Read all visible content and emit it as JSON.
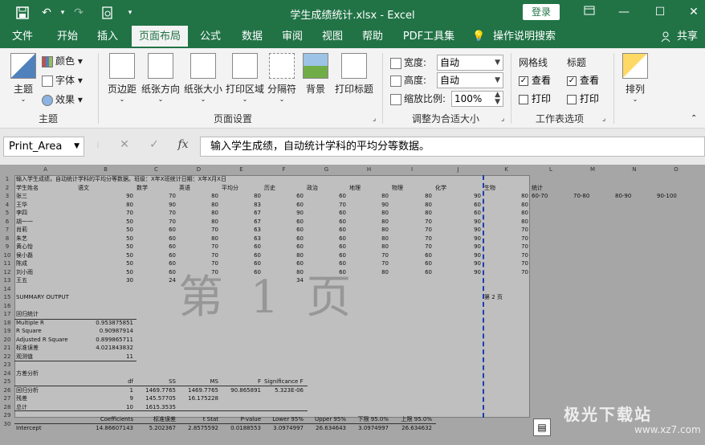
{
  "title": {
    "filename": "学生成绩统计.xlsx",
    "app": "Excel",
    "login": "登录"
  },
  "tabs": [
    "文件",
    "开始",
    "插入",
    "页面布局",
    "公式",
    "数据",
    "审阅",
    "视图",
    "帮助",
    "PDF工具集",
    "操作说明搜索",
    "共享"
  ],
  "ribbon": {
    "theme": {
      "big": "主题",
      "colors": "颜色",
      "fonts": "字体",
      "effects": "效果",
      "group": "主题"
    },
    "page_setup": {
      "margins": "页边距",
      "orientation": "纸张方向",
      "size": "纸张大小",
      "print_area": "打印区域",
      "breaks": "分隔符",
      "background": "背景",
      "print_titles": "打印标题",
      "group": "页面设置"
    },
    "scale": {
      "width_label": "宽度:",
      "width_value": "自动",
      "height_label": "高度:",
      "height_value": "自动",
      "scale_label": "缩放比例:",
      "scale_value": "100%",
      "group": "调整为合适大小"
    },
    "sheet_options": {
      "gridlines": "网格线",
      "headings": "标题",
      "view": "查看",
      "print": "打印",
      "view2": "查看",
      "print2": "打印",
      "group": "工作表选项"
    },
    "arrange": {
      "label": "排列"
    }
  },
  "formula": {
    "namebox": "Print_Area",
    "fx": "fx",
    "content": "输入学生成绩，自动统计学科的平均分等数据。"
  },
  "columns": [
    "A",
    "B",
    "C",
    "D",
    "E",
    "F",
    "G",
    "H",
    "I",
    "J",
    "K",
    "L",
    "M",
    "N",
    "O"
  ],
  "rows": [
    "1",
    "2",
    "3",
    "4",
    "5",
    "6",
    "7",
    "8",
    "9",
    "10",
    "11",
    "12",
    "13",
    "14",
    "15",
    "16",
    "17",
    "18",
    "19",
    "20",
    "21",
    "22",
    "23",
    "24",
    "25",
    "26",
    "27",
    "28",
    "29",
    "30"
  ],
  "sheet": {
    "row1": "输入学生成绩，自动统计学科的平均分等数据。班级：X年X班统计日期：X年X月X日",
    "header": [
      "学生姓名",
      "语文",
      "数学",
      "英语",
      "平均分",
      "历史",
      "政治",
      "地理",
      "物理",
      "化学",
      "生物"
    ],
    "students": [
      [
        "张三",
        "90",
        "70",
        "80",
        "80",
        "60",
        "60",
        "80",
        "80",
        "90",
        "80"
      ],
      [
        "王华",
        "80",
        "90",
        "80",
        "83",
        "60",
        "70",
        "90",
        "80",
        "60",
        "80"
      ],
      [
        "李四",
        "70",
        "70",
        "80",
        "67",
        "90",
        "60",
        "80",
        "80",
        "60",
        "80"
      ],
      [
        "胡一一",
        "50",
        "70",
        "80",
        "67",
        "60",
        "60",
        "80",
        "70",
        "90",
        "80"
      ],
      [
        "肖莉",
        "50",
        "60",
        "70",
        "63",
        "60",
        "60",
        "80",
        "70",
        "90",
        "70"
      ],
      [
        "朱艺",
        "50",
        "60",
        "80",
        "63",
        "60",
        "60",
        "80",
        "70",
        "90",
        "70"
      ],
      [
        "黄心怡",
        "50",
        "60",
        "70",
        "60",
        "60",
        "60",
        "80",
        "70",
        "90",
        "70"
      ],
      [
        "侯小磊",
        "50",
        "60",
        "70",
        "60",
        "80",
        "60",
        "70",
        "60",
        "90",
        "70"
      ],
      [
        "陈成",
        "50",
        "60",
        "70",
        "60",
        "60",
        "60",
        "70",
        "60",
        "90",
        "70"
      ],
      [
        "刘小雨",
        "50",
        "60",
        "70",
        "60",
        "80",
        "60",
        "80",
        "60",
        "90",
        "70"
      ],
      [
        "王五",
        "30",
        "24",
        "",
        "",
        "34",
        "",
        "",
        "",
        "",
        ""
      ]
    ],
    "summary": "SUMMARY OUTPUT",
    "reg_title": "回归统计",
    "reg": [
      [
        "Multiple R",
        "0.953875851"
      ],
      [
        "R Square",
        "0.90987914"
      ],
      [
        "Adjusted R Square",
        "0.899865711"
      ],
      [
        "标准误差",
        "4.021843832"
      ],
      [
        "观测值",
        "11"
      ]
    ],
    "anova_title": "方差分析",
    "anova_hdr": [
      "df",
      "SS",
      "MS",
      "F",
      "Significance F"
    ],
    "anova": [
      [
        "回归分析",
        "1",
        "1469.7765",
        "1469.7765",
        "90.865891",
        "5.323E-06"
      ],
      [
        "残差",
        "9",
        "145.57705",
        "16.175228",
        "",
        ""
      ],
      [
        "总计",
        "10",
        "1615.3535",
        "",
        "",
        ""
      ]
    ],
    "coef_hdr": [
      "Coefficients",
      "标准误差",
      "t Stat",
      "P-value",
      "Lower 95%",
      "Upper 95%",
      "下限 95.0%",
      "上限 95.0%"
    ],
    "coef_row": [
      "Intercept",
      "14.86607143",
      "5.202367",
      "2.8575592",
      "0.0188553",
      "3.0974997",
      "26.634643",
      "3.0974997",
      "26.634632"
    ],
    "stat_label": "统计",
    "ranges": [
      "60-70",
      "70-80",
      "80-90",
      "90-100"
    ],
    "watermark": "第 1 页",
    "page2": "第 2 页"
  },
  "logo": {
    "main": "极光下载站",
    "url": "www.xz7.com"
  }
}
